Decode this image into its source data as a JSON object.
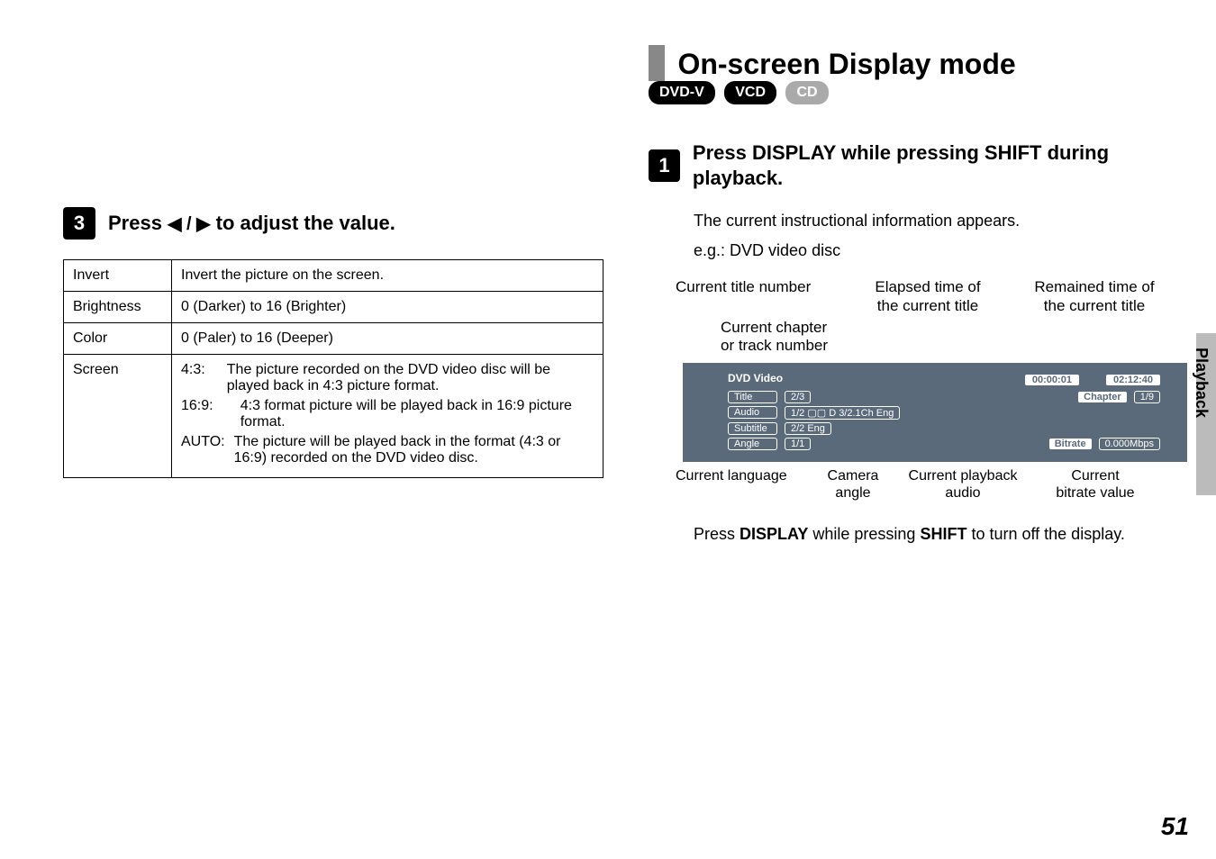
{
  "left": {
    "step_num": "3",
    "step_text_pre": "Press ",
    "step_text_post": " to adjust the value.",
    "arrows": "◀ / ▶",
    "table": {
      "rows": [
        {
          "label": "Invert",
          "desc": "Invert the picture on the screen."
        },
        {
          "label": "Brightness",
          "desc": "0 (Darker) to 16 (Brighter)"
        },
        {
          "label": "Color",
          "desc": "0 (Paler) to 16 (Deeper)"
        }
      ],
      "screen_label": "Screen",
      "screen_items": [
        {
          "k": "4:3:",
          "v": "The picture recorded on the DVD video disc will be played back in 4:3 picture format."
        },
        {
          "k": "16:9:",
          "v": "4:3 format picture will be played back in 16:9 picture format."
        },
        {
          "k": "AUTO:",
          "v": "The picture will be played back in the format (4:3 or 16:9) recorded on the DVD video disc."
        }
      ]
    }
  },
  "right": {
    "title": "On-screen Display mode",
    "pills": [
      "DVD-V",
      "VCD",
      "CD"
    ],
    "step_num": "1",
    "step_text": "Press DISPLAY while pressing SHIFT during playback.",
    "body1": "The current instructional information appears.",
    "eg": "e.g.: DVD video disc",
    "top_labels": {
      "l1": "Current title number",
      "l2a": "Elapsed time of",
      "l2b": "the current title",
      "l3a": "Remained time of",
      "l3b": "the current title",
      "mid1": "Current chapter",
      "mid2": "or track number"
    },
    "osd": {
      "dvd": "DVD Video",
      "elapsed": "00:00:01",
      "remain": "02:12:40",
      "title_l": "Title",
      "title_v": "2/3",
      "chapter_l": "Chapter",
      "chapter_v": "1/9",
      "audio_l": "Audio",
      "audio_v": "1/2 ▢▢ D 3/2.1Ch Eng",
      "subtitle_l": "Subtitle",
      "subtitle_v": "2/2 Eng",
      "angle_l": "Angle",
      "angle_v": "1/1",
      "bitrate_l": "Bitrate",
      "bitrate_v": "0.000Mbps"
    },
    "bottom_labels": {
      "b1": "Current language",
      "b2a": "Camera",
      "b2b": "angle",
      "b3a": "Current playback",
      "b3b": "audio",
      "b4a": "Current",
      "b4b": "bitrate value"
    },
    "body2_pre": "Press ",
    "body2_bold1": "DISPLAY",
    "body2_mid": " while pressing ",
    "body2_bold2": "SHIFT",
    "body2_post": " to turn off the display."
  },
  "side_tab": "Playback",
  "page_num": "51"
}
